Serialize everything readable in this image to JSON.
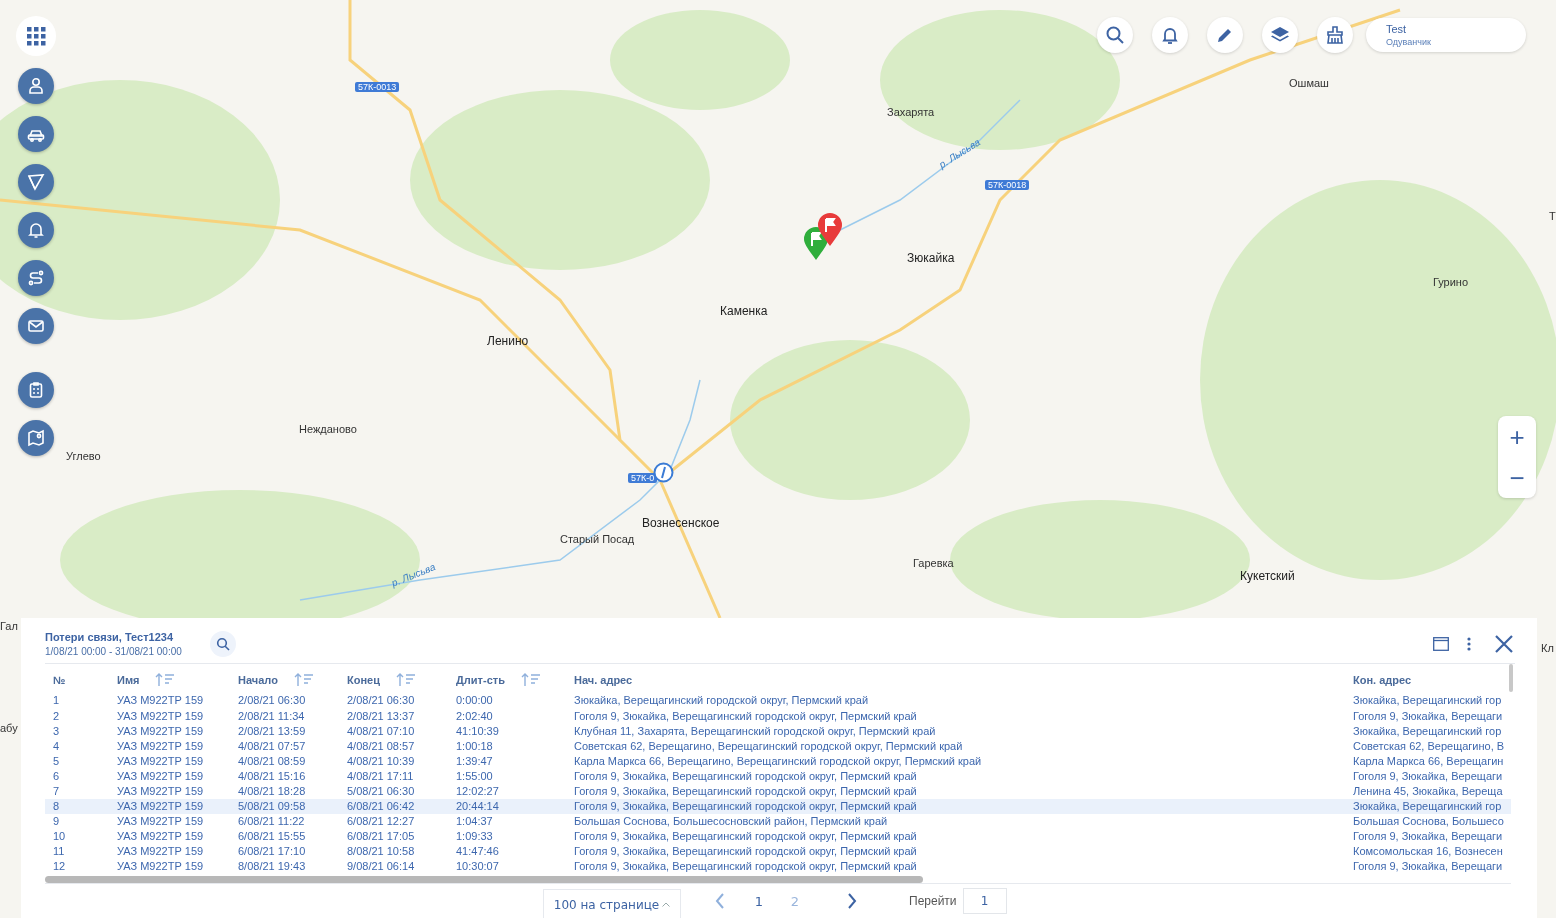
{
  "map": {
    "labels": [
      {
        "text": "Захарята",
        "kind": "place"
      },
      {
        "text": "Ошмаш",
        "kind": "place"
      },
      {
        "text": "Зюкайка",
        "kind": "town"
      },
      {
        "text": "Каменка",
        "kind": "town"
      },
      {
        "text": "Ленино",
        "kind": "town"
      },
      {
        "text": "Гурино",
        "kind": "place"
      },
      {
        "text": "Нежданово",
        "kind": "place"
      },
      {
        "text": "Углево",
        "kind": "place"
      },
      {
        "text": "Вознесенское",
        "kind": "town"
      },
      {
        "text": "Старый Посад",
        "kind": "place"
      },
      {
        "text": "Гаревка",
        "kind": "place"
      },
      {
        "text": "Кукетский",
        "kind": "town"
      },
      {
        "text": "р. Лысьва",
        "kind": "river"
      },
      {
        "text": "р. Лысьва",
        "kind": "river"
      },
      {
        "text": "57К-0013",
        "kind": "road"
      },
      {
        "text": "57К-0018",
        "kind": "road"
      },
      {
        "text": "57К-0",
        "kind": "road"
      },
      {
        "text": "Гал",
        "kind": "place"
      },
      {
        "text": "абу",
        "kind": "place"
      },
      {
        "text": "Кл",
        "kind": "place"
      },
      {
        "text": "Т",
        "kind": "place"
      }
    ],
    "zoom": [
      "+",
      "−"
    ]
  },
  "user": {
    "name": "Test",
    "org": "Одуванчик"
  },
  "panel": {
    "title": "Потери связи, Тест1234",
    "period": "1/08/21 00:00 - 31/08/21 00:00",
    "columns": [
      {
        "label": "№",
        "sortable": false
      },
      {
        "label": "Имя",
        "sortable": true
      },
      {
        "label": "Начало",
        "sortable": true
      },
      {
        "label": "Конец",
        "sortable": true
      },
      {
        "label": "Длит-сть",
        "sortable": true
      },
      {
        "label": "Нач. адрес",
        "sortable": false
      },
      {
        "label": "Кон. адрес",
        "sortable": false
      }
    ],
    "rows": [
      {
        "selected": false,
        "cells": [
          "1",
          "УАЗ М922ТР 159",
          "2/08/21 06:30",
          "2/08/21 06:30",
          "0:00:00",
          "Зюкайка, Верещагинский городской округ, Пермский край",
          "Зюкайка, Верещагинский гор"
        ]
      },
      {
        "selected": false,
        "cells": [
          "2",
          "УАЗ М922ТР 159",
          "2/08/21 11:34",
          "2/08/21 13:37",
          "2:02:40",
          "Гоголя 9, Зюкайка, Верещагинский городской округ, Пермский край",
          "Гоголя 9, Зюкайка, Верещаги"
        ]
      },
      {
        "selected": false,
        "cells": [
          "3",
          "УАЗ М922ТР 159",
          "2/08/21 13:59",
          "4/08/21 07:10",
          "41:10:39",
          "Клубная 11, Захарята, Верещагинский городской округ, Пермский край",
          "Зюкайка, Верещагинский гор"
        ]
      },
      {
        "selected": false,
        "cells": [
          "4",
          "УАЗ М922ТР 159",
          "4/08/21 07:57",
          "4/08/21 08:57",
          "1:00:18",
          "Советская 62, Верещагино, Верещагинский городской округ, Пермский край",
          "Советская 62, Верещагино, В"
        ]
      },
      {
        "selected": false,
        "cells": [
          "5",
          "УАЗ М922ТР 159",
          "4/08/21 08:59",
          "4/08/21 10:39",
          "1:39:47",
          "Карла Маркса 66, Верещагино, Верещагинский городской округ, Пермский край",
          "Карла Маркса 66, Верещагин"
        ]
      },
      {
        "selected": false,
        "cells": [
          "6",
          "УАЗ М922ТР 159",
          "4/08/21 15:16",
          "4/08/21 17:11",
          "1:55:00",
          "Гоголя 9, Зюкайка, Верещагинский городской округ, Пермский край",
          "Гоголя 9, Зюкайка, Верещаги"
        ]
      },
      {
        "selected": false,
        "cells": [
          "7",
          "УАЗ М922ТР 159",
          "4/08/21 18:28",
          "5/08/21 06:30",
          "12:02:27",
          "Гоголя 9, Зюкайка, Верещагинский городской округ, Пермский край",
          "Ленина 45, Зюкайка, Вереща"
        ]
      },
      {
        "selected": true,
        "cells": [
          "8",
          "УАЗ М922ТР 159",
          "5/08/21 09:58",
          "6/08/21 06:42",
          "20:44:14",
          "Гоголя 9, Зюкайка, Верещагинский городской округ, Пермский край",
          "Зюкайка, Верещагинский гор"
        ]
      },
      {
        "selected": false,
        "cells": [
          "9",
          "УАЗ М922ТР 159",
          "6/08/21 11:22",
          "6/08/21 12:27",
          "1:04:37",
          "Большая Соснова, Большесосновский район, Пермский край",
          "Большая Соснова, Большесо"
        ]
      },
      {
        "selected": false,
        "cells": [
          "10",
          "УАЗ М922ТР 159",
          "6/08/21 15:55",
          "6/08/21 17:05",
          "1:09:33",
          "Гоголя 9, Зюкайка, Верещагинский городской округ, Пермский край",
          "Гоголя 9, Зюкайка, Верещаги"
        ]
      },
      {
        "selected": false,
        "cells": [
          "11",
          "УАЗ М922ТР 159",
          "6/08/21 17:10",
          "8/08/21 10:58",
          "41:47:46",
          "Гоголя 9, Зюкайка, Верещагинский городской округ, Пермский край",
          "Комсомольская 16, Вознесен"
        ]
      },
      {
        "selected": false,
        "cells": [
          "12",
          "УАЗ М922ТР 159",
          "8/08/21 19:43",
          "9/08/21 06:14",
          "10:30:07",
          "Гоголя 9, Зюкайка, Верещагинский городской округ, Пермский край",
          "Гоголя 9, Зюкайка, Верещаги"
        ]
      }
    ],
    "pagination": {
      "per_page": "100 на странице",
      "pages": [
        {
          "label": "1",
          "selected": true
        },
        {
          "label": "2",
          "selected": false
        }
      ],
      "goto_label": "Перейти",
      "goto_value": "1"
    }
  }
}
